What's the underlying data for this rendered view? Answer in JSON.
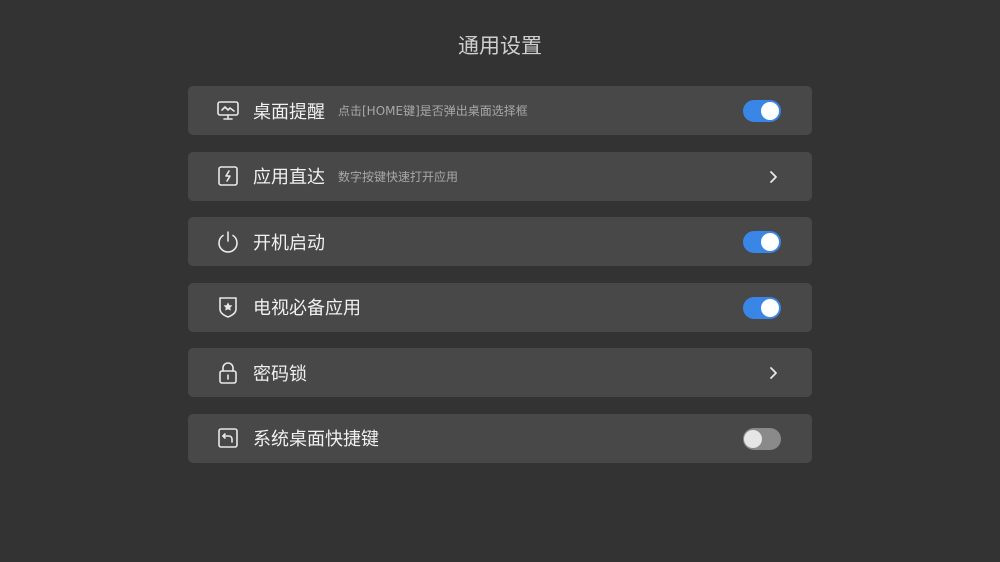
{
  "page": {
    "title": "通用设置"
  },
  "settings": {
    "items": [
      {
        "label": "桌面提醒",
        "subtitle": "点击[HOME键]是否弹出桌面选择框",
        "control": "toggle",
        "enabled": true,
        "icon": "monitor-icon"
      },
      {
        "label": "应用直达",
        "subtitle": "数字按键快速打开应用",
        "control": "chevron",
        "icon": "lightning-icon"
      },
      {
        "label": "开机启动",
        "subtitle": "",
        "control": "toggle",
        "enabled": true,
        "icon": "power-icon"
      },
      {
        "label": "电视必备应用",
        "subtitle": "",
        "control": "toggle",
        "enabled": true,
        "icon": "shield-star-icon"
      },
      {
        "label": "密码锁",
        "subtitle": "",
        "control": "chevron",
        "icon": "lock-icon"
      },
      {
        "label": "系统桌面快捷键",
        "subtitle": "",
        "control": "toggle",
        "enabled": false,
        "icon": "return-icon"
      }
    ]
  },
  "colors": {
    "background": "#333333",
    "row": "#484848",
    "toggle_on": "#3a86e6",
    "toggle_off": "#8a8a8a"
  }
}
